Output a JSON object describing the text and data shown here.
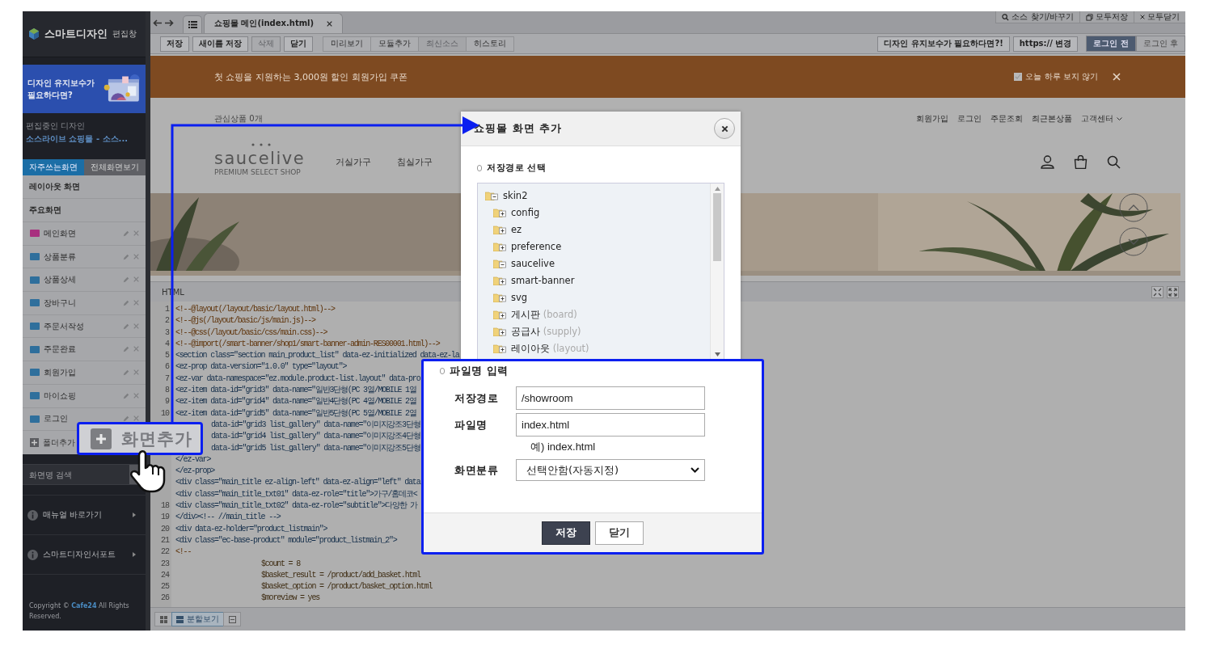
{
  "sidebar": {
    "logo": {
      "title": "스마트디자인",
      "subtitle": "편집창"
    },
    "promo": {
      "lines": [
        "디자인 유지보수가",
        "필요하다면?"
      ]
    },
    "editing": {
      "label": "편집중인 디자인",
      "name": "소스라이브 쇼핑몰 - 소스..."
    },
    "tabs": [
      {
        "label": "자주쓰는화면",
        "selected": true
      },
      {
        "label": "전체화면보기",
        "selected": false
      }
    ],
    "sections": [
      "레이아웃 화면",
      "주요화면"
    ],
    "screens": [
      {
        "label": "메인화면",
        "color": "#a8307f"
      },
      {
        "label": "상품분류",
        "color": "#2f6f9c"
      },
      {
        "label": "상품상세",
        "color": "#2f6f9c"
      },
      {
        "label": "장바구니",
        "color": "#2f6f9c"
      },
      {
        "label": "주문서작성",
        "color": "#2f6f9c"
      },
      {
        "label": "주문완료",
        "color": "#2f6f9c"
      },
      {
        "label": "회원가입",
        "color": "#2f6f9c"
      },
      {
        "label": "마이쇼핑",
        "color": "#2f6f9c"
      },
      {
        "label": "로그인",
        "color": "#2f6f9c"
      }
    ],
    "add_folder": "폴더추가",
    "search": {
      "placeholder": "화면명 검색"
    },
    "links": [
      "매뉴얼 바로가기",
      "스마트디자인서포트"
    ],
    "copyright": "Copyright © **Cafe24** All Rights Reserved."
  },
  "tab_bar": {
    "tabs": [
      {
        "label": "쇼핑몰 메인(index.html)",
        "selected": true
      }
    ],
    "tools": [
      {
        "kind": "search",
        "label": "소스 찾기/바꾸기"
      },
      {
        "kind": "save",
        "label": "모두저장"
      },
      {
        "kind": "close",
        "label": "모두닫기"
      }
    ]
  },
  "toolbar": {
    "file_buttons": [
      {
        "label": "저장",
        "disabled": false
      },
      {
        "label": "새이름 저장",
        "disabled": false
      },
      {
        "label": "삭제",
        "disabled": true
      },
      {
        "label": "닫기",
        "disabled": false
      }
    ],
    "view_buttons": [
      {
        "label": "미리보기",
        "disabled": false
      },
      {
        "label": "모듈추가",
        "disabled": false
      },
      {
        "label": "최신소스",
        "disabled": true
      },
      {
        "label": "히스토리",
        "disabled": false
      }
    ],
    "promo_button": "디자인 유지보수가 필요하다면?!",
    "https_button": "https:// 변경",
    "login_toggle": [
      {
        "label": "로그인 전",
        "selected": true
      },
      {
        "label": "로그인 후",
        "selected": false
      }
    ]
  },
  "preview": {
    "banner": {
      "text": "첫 쇼핑을 지원하는 3,000원 할인 회원가입 쿠폰",
      "hide_today": {
        "label": "오늘 하루 보지 않기",
        "checked": true
      }
    },
    "wishlist": "관심상품 0개",
    "top_links": [
      "회원가입",
      "로그인",
      "주문조회",
      "최근본상품"
    ],
    "support_menu": "고객센터",
    "logo": {
      "name": "saucelive",
      "tagline": "PREMIUM SELECT SHOP"
    },
    "categories": [
      "거실가구",
      "침실가구"
    ]
  },
  "editor": {
    "panel_title": "HTML",
    "lines": [
      {
        "number": "1",
        "kind": "comment",
        "text": "<!--@layout(/layout/basic/layout.html)-->"
      },
      {
        "number": "2",
        "kind": "comment",
        "text": "<!--@js(/layout/basic/js/main.js)-->"
      },
      {
        "number": "3",
        "kind": "comment",
        "text": "<!--@css(/layout/basic/css/main.css)-->"
      },
      {
        "number": "4",
        "kind": "comment",
        "text": "<!--@import(/smart-banner/shop1/smart-banner-admin-RES00001.html)-->"
      },
      {
        "number": "5",
        "kind": "tag",
        "text": "<section class=\"section main_product_list\" data-ez-initialized data-ez-la"
      },
      {
        "number": "6",
        "kind": "tag",
        "text": "<ez-prop data-version=\"1.0.0\" type=\"layout\">"
      },
      {
        "number": "7",
        "kind": "tag",
        "text": "<ez-var data-namespace=\"ez.module.product-list.layout\" data-pro"
      },
      {
        "number": "8",
        "kind": "tag",
        "text": "<ez-item data-id=\"grid3\" data-name=\"일반3단형(PC 3열/MOBILE 1열"
      },
      {
        "number": "9",
        "kind": "tag",
        "text": "<ez-item data-id=\"grid4\" data-name=\"일반4단형(PC 4열/MOBILE 2열"
      },
      {
        "number": "10",
        "kind": "tag",
        "text": "<ez-item data-id=\"grid5\" data-name=\"일반5단형(PC 5열/MOBILE 2열"
      },
      {
        "kind": "covered",
        "text": "data-id=\"grid3 list_gallery\" data-name=\"이미지강조3단형"
      },
      {
        "kind": "covered",
        "text": "data-id=\"grid4 list_gallery\" data-name=\"이미지강조4단형"
      },
      {
        "kind": "covered",
        "text": "data-id=\"grid5 list_gallery\" data-name=\"이미지강조5단형"
      },
      {
        "kind": "tag",
        "text": "</ez-var>"
      },
      {
        "kind": "tag",
        "text": "</ez-prop>"
      },
      {
        "kind": "tag",
        "text": "<div class=\"main_title ez-align-left\" data-ez-align=\"left\" data"
      },
      {
        "kind": "tag",
        "text": "<div class=\"main_title_txt01\" data-ez-role=\"title\">가구/홈데코<"
      },
      {
        "number": "18",
        "kind": "tag",
        "text": "<div class=\"main_title_txt02\" data-ez-role=\"subtitle\">다양한 가"
      },
      {
        "number": "19",
        "kind": "tag",
        "text": "</div><!-- //main_title -->"
      },
      {
        "number": "20",
        "kind": "tag",
        "text": "<div data-ez-holder=\"product_listmain\">"
      },
      {
        "number": "21",
        "kind": "tag",
        "text": "<div class=\"ec-base-product\" module=\"product_listmain_2\">"
      },
      {
        "number": "22",
        "kind": "comment",
        "text": "<!--"
      },
      {
        "number": "23",
        "kind": "param",
        "text": "$count = 8"
      },
      {
        "number": "24",
        "kind": "param",
        "text": "$basket_result = /product/add_basket.html"
      },
      {
        "number": "25",
        "kind": "param",
        "text": "$basket_option = /product/basket_option.html"
      },
      {
        "number": "26",
        "kind": "param",
        "text": "$moreview = yes"
      }
    ],
    "view_modes": [
      {
        "kind": "grid",
        "selected": false
      },
      {
        "kind": "split",
        "label": "분할보기",
        "selected": true
      },
      {
        "kind": "single",
        "selected": false
      }
    ]
  },
  "dialog": {
    "title": "쇼핑몰 화면 추가",
    "path_section": "저장경로 선택",
    "tree": [
      {
        "name": "skin2",
        "expanded": true,
        "children": [
          {
            "name": "config",
            "expanded": false
          },
          {
            "name": "ez",
            "expanded": false
          },
          {
            "name": "preference",
            "expanded": false
          },
          {
            "name": "saucelive",
            "expanded": true
          },
          {
            "name": "smart-banner",
            "expanded": false
          },
          {
            "name": "svg",
            "expanded": false
          },
          {
            "name": "게시판",
            "note": "(board)",
            "expanded": false
          },
          {
            "name": "공급사",
            "note": "(supply)",
            "expanded": false
          },
          {
            "name": "레이아웃",
            "note": "(layout)",
            "expanded": false
          }
        ]
      }
    ]
  },
  "callout": {
    "section": "파일명 입력",
    "fields": [
      {
        "kind": "text",
        "label": "저장경로",
        "value": "/showroom"
      },
      {
        "kind": "text",
        "label": "파일명",
        "value": "index.html",
        "hint": "예) index.html"
      },
      {
        "kind": "select",
        "label": "화면분류",
        "value": "선택안함(자동지정)"
      }
    ],
    "buttons": [
      {
        "label": "저장",
        "primary": true
      },
      {
        "label": "닫기",
        "primary": false
      }
    ]
  },
  "add_screen_button": "화면추가"
}
